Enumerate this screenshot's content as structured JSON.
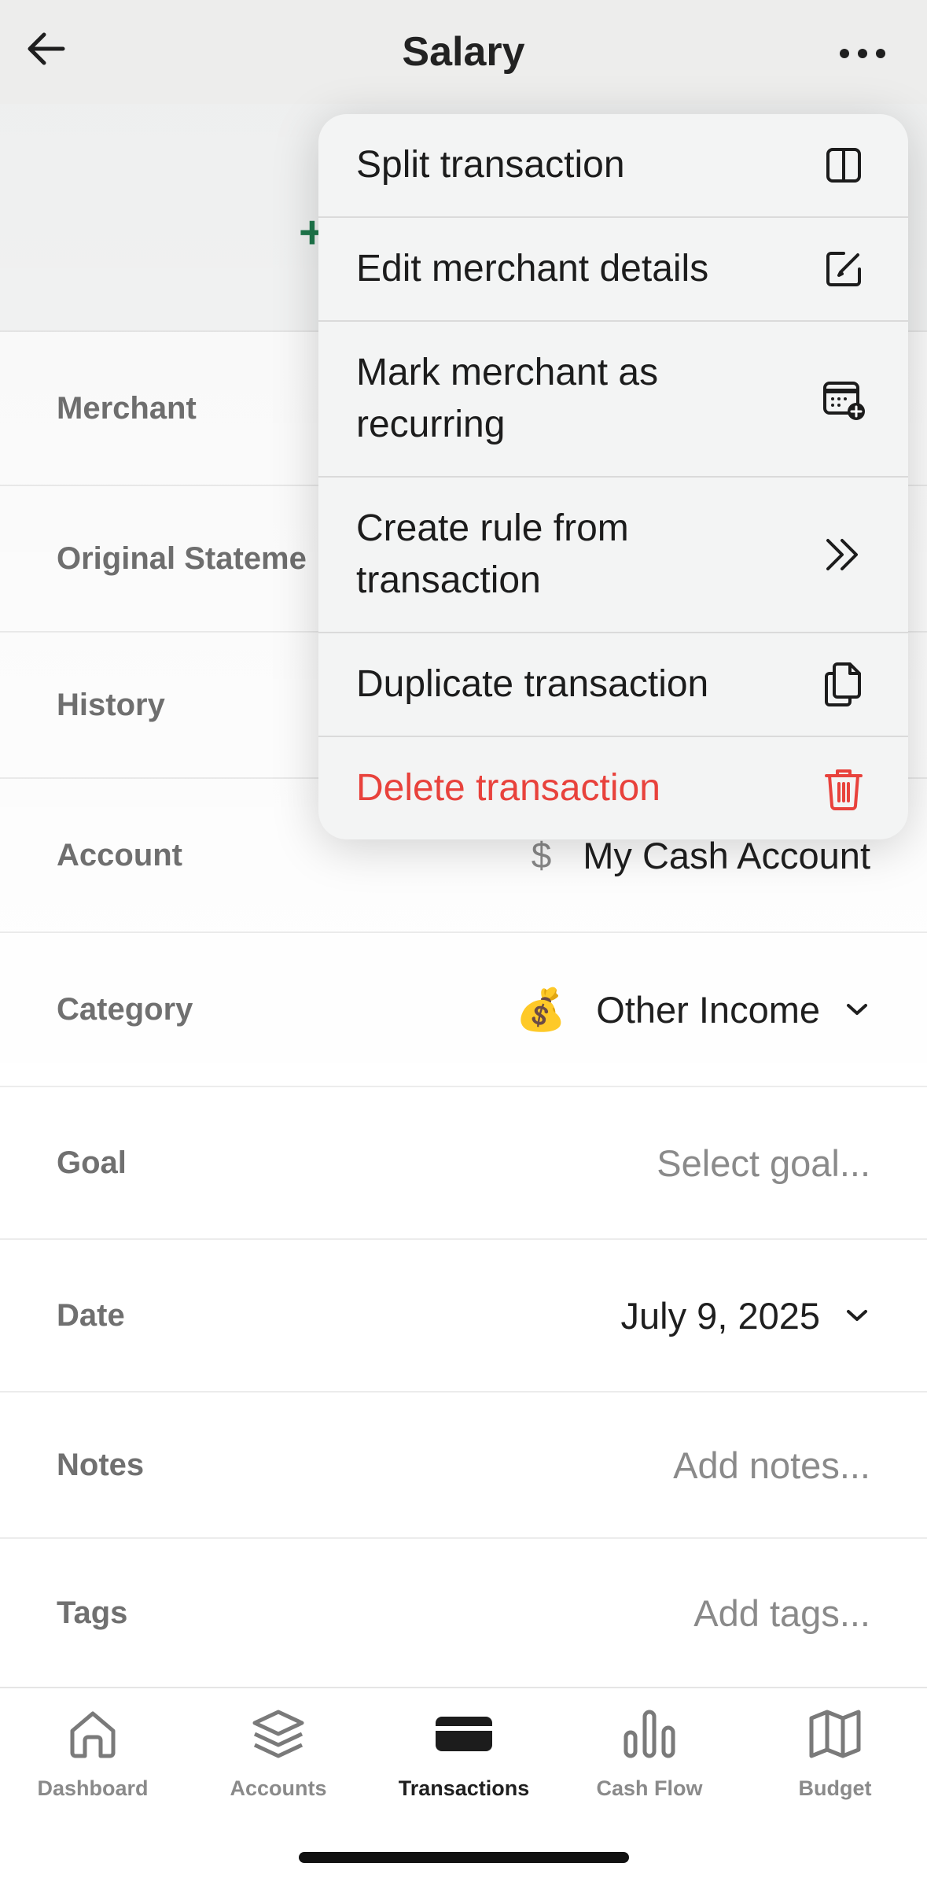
{
  "header": {
    "title": "Salary"
  },
  "hero": {
    "amount_sign": "+"
  },
  "rows": {
    "merchant": {
      "label": "Merchant"
    },
    "original_statement": {
      "label": "Original Stateme"
    },
    "history": {
      "label": "History"
    },
    "account": {
      "label": "Account",
      "value": "My Cash Account",
      "icon": "dollar-icon",
      "icon_glyph": "$"
    },
    "category": {
      "label": "Category",
      "value": "Other Income",
      "icon": "money-bag-icon",
      "icon_glyph": "💰"
    },
    "goal": {
      "label": "Goal",
      "placeholder": "Select goal..."
    },
    "date": {
      "label": "Date",
      "value": "July 9, 2025"
    },
    "notes": {
      "label": "Notes",
      "placeholder": "Add notes..."
    },
    "tags": {
      "label": "Tags",
      "placeholder": "Add tags..."
    }
  },
  "menu": {
    "items": [
      {
        "label": "Split transaction",
        "icon": "split-icon"
      },
      {
        "label": "Edit merchant details",
        "icon": "edit-icon"
      },
      {
        "label": "Mark merchant as recurring",
        "icon": "calendar-add-icon"
      },
      {
        "label": "Create rule from transaction",
        "icon": "double-chevron-right-icon"
      },
      {
        "label": "Duplicate transaction",
        "icon": "duplicate-icon"
      },
      {
        "label": "Delete transaction",
        "icon": "trash-icon",
        "color": "#e8423c"
      }
    ]
  },
  "tabs": [
    {
      "label": "Dashboard",
      "icon": "home-icon"
    },
    {
      "label": "Accounts",
      "icon": "layers-icon"
    },
    {
      "label": "Transactions",
      "icon": "card-icon",
      "active": true
    },
    {
      "label": "Cash Flow",
      "icon": "bar-chart-icon"
    },
    {
      "label": "Budget",
      "icon": "map-icon"
    }
  ],
  "colors": {
    "accent_green": "#1f7a4d",
    "danger": "#e8423c"
  }
}
